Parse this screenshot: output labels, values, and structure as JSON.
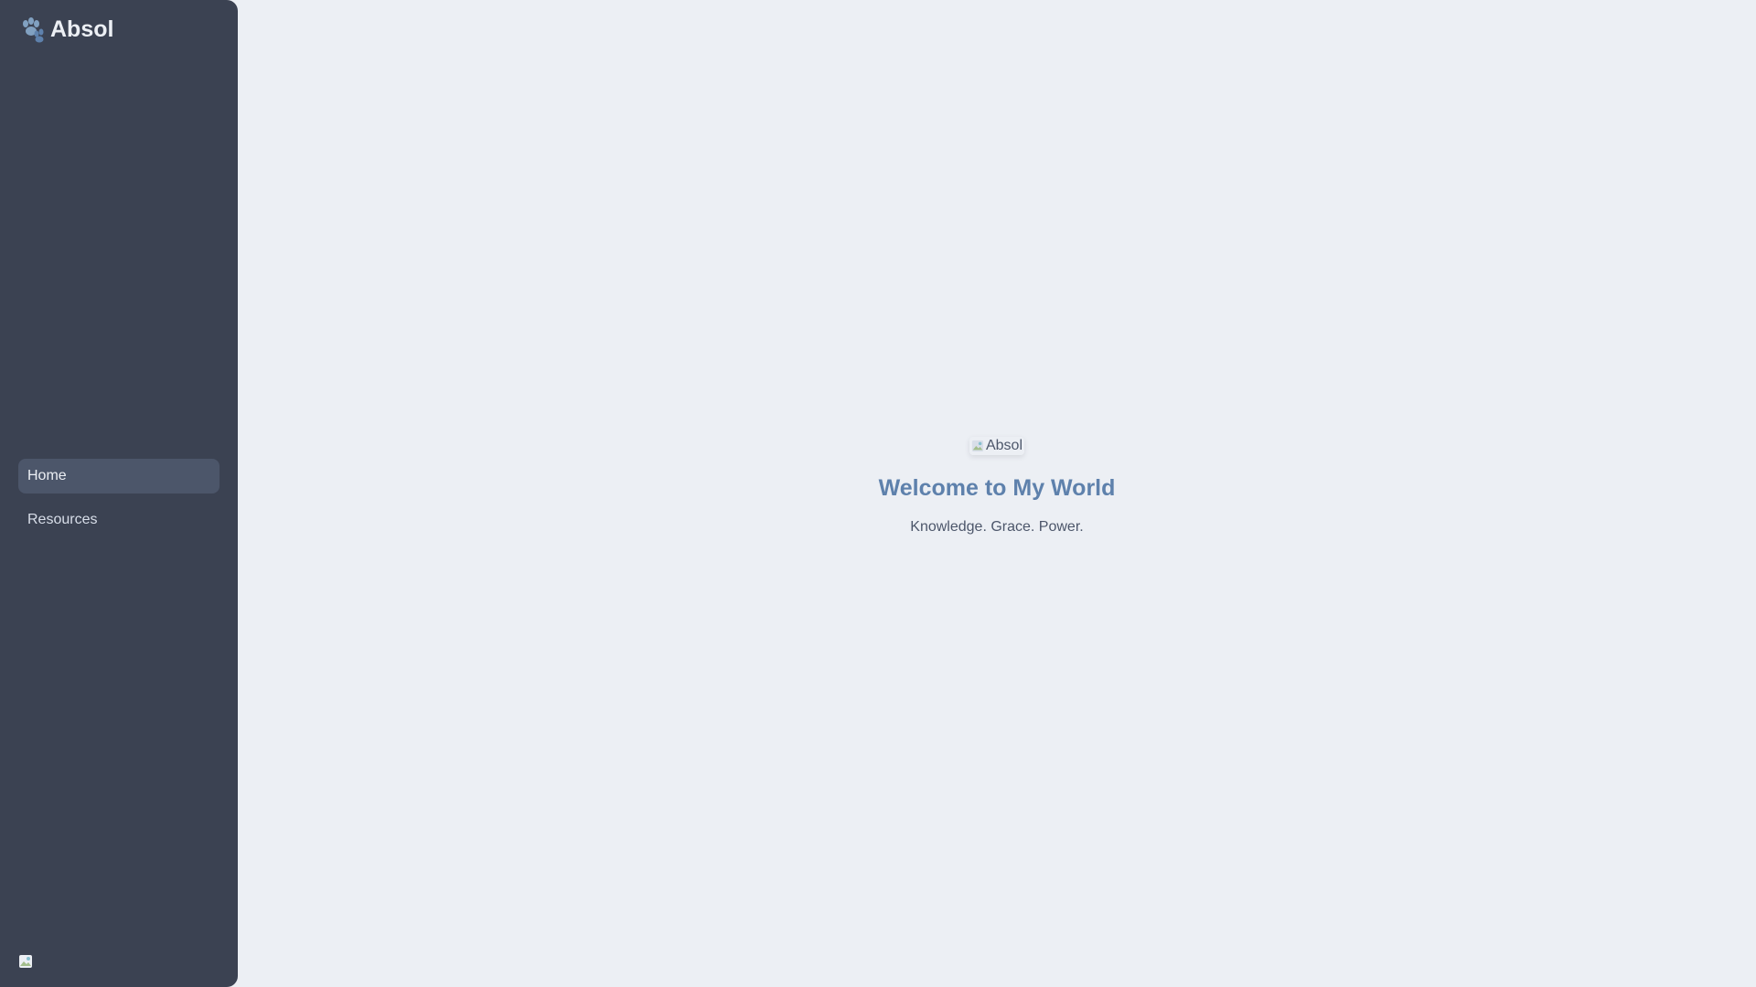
{
  "app": {
    "brand_name": "Absol",
    "brand_icon": "paw-icon"
  },
  "sidebar": {
    "items": [
      {
        "label": "Home",
        "active": true
      },
      {
        "label": "Resources",
        "active": false
      }
    ],
    "profile_icon": "broken-image-icon"
  },
  "hero": {
    "image_alt": "Absol",
    "title": "Welcome to My World",
    "subtitle": "Knowledge. Grace. Power."
  },
  "colors": {
    "sidebar_bg": "#3b4252",
    "main_bg": "#eceff4",
    "active_item_bg": "#4c566a",
    "title_color": "#5e81ac",
    "brand_icon_color": "#88c0d0"
  }
}
